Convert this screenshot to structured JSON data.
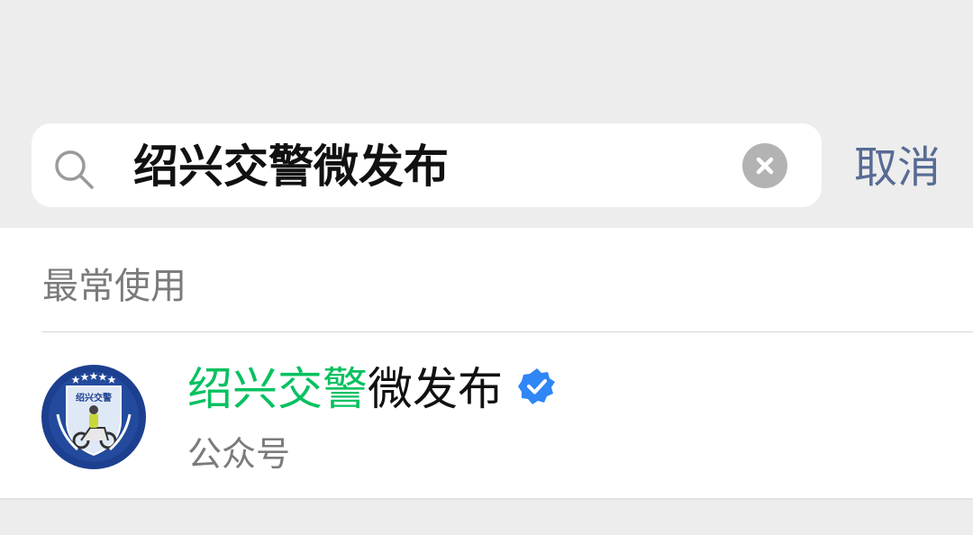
{
  "search": {
    "query": "绍兴交警微发布",
    "cancel_label": "取消"
  },
  "section": {
    "title": "最常使用"
  },
  "result": {
    "name_highlight": "绍兴交警",
    "name_rest": "微发布",
    "type": "公众号",
    "avatar_label": "绍兴交警",
    "verified": true
  },
  "colors": {
    "highlight": "#07c160",
    "link": "#576b95",
    "verified": "#2f86f5",
    "avatar_bg": "#1d3f8f"
  }
}
